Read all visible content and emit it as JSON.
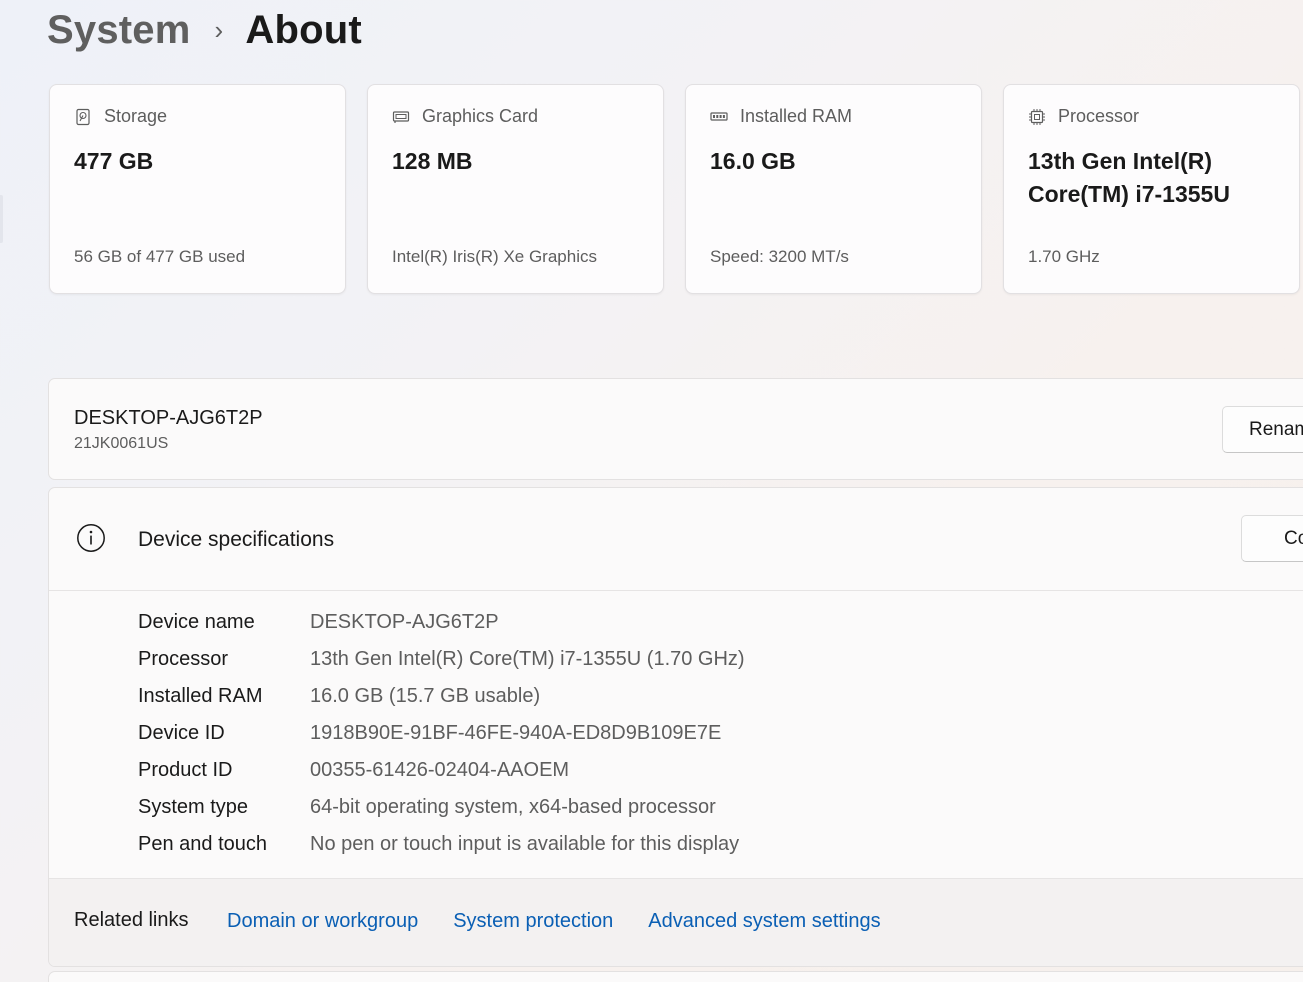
{
  "breadcrumb": {
    "parent": "System",
    "separator": "›",
    "current": "About"
  },
  "cards": [
    {
      "icon": "storage-icon",
      "title": "Storage",
      "value": "477 GB",
      "sub": "56 GB of 477 GB used"
    },
    {
      "icon": "graphics-card-icon",
      "title": "Graphics Card",
      "value": "128 MB",
      "sub": "Intel(R) Iris(R) Xe Graphics"
    },
    {
      "icon": "ram-icon",
      "title": "Installed RAM",
      "value": "16.0 GB",
      "sub": "Speed: 3200 MT/s"
    },
    {
      "icon": "processor-icon",
      "title": "Processor",
      "value": "13th Gen Intel(R) Core(TM) i7-1355U",
      "sub": "1.70 GHz"
    }
  ],
  "device": {
    "name": "DESKTOP-AJG6T2P",
    "model": "21JK0061US",
    "rename_label": "Renam"
  },
  "specs": {
    "title": "Device specifications",
    "copy_label": "Co",
    "rows": [
      {
        "label": "Device name",
        "value": "DESKTOP-AJG6T2P"
      },
      {
        "label": "Processor",
        "value": "13th Gen Intel(R) Core(TM) i7-1355U (1.70 GHz)"
      },
      {
        "label": "Installed RAM",
        "value": "16.0 GB (15.7 GB usable)"
      },
      {
        "label": "Device ID",
        "value": "1918B90E-91BF-46FE-940A-ED8D9B109E7E"
      },
      {
        "label": "Product ID",
        "value": "00355-61426-02404-AAOEM"
      },
      {
        "label": "System type",
        "value": "64-bit operating system, x64-based processor"
      },
      {
        "label": "Pen and touch",
        "value": "No pen or touch input is available for this display"
      }
    ]
  },
  "related": {
    "title": "Related links",
    "links": [
      "Domain or workgroup",
      "System protection",
      "Advanced system settings"
    ]
  },
  "colors": {
    "link": "#0a5fb4",
    "secondary_text": "#5d5d5d"
  }
}
